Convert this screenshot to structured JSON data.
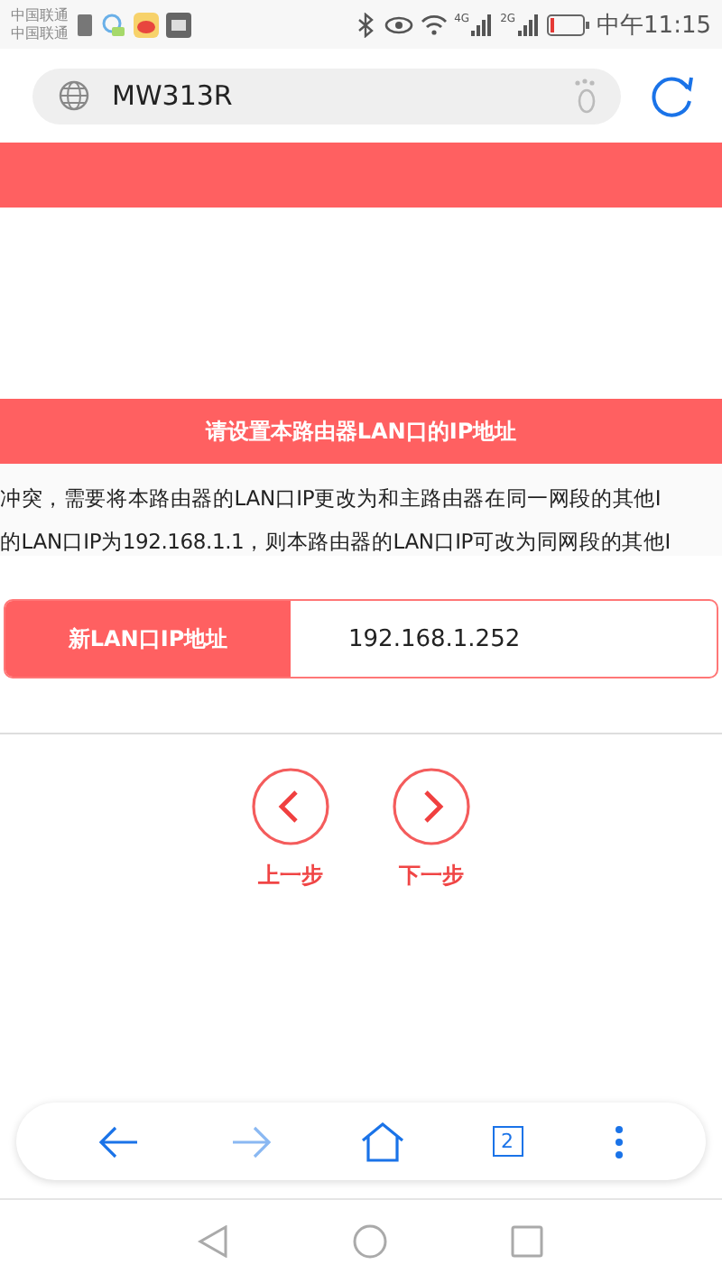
{
  "status_bar": {
    "carriers": [
      "中国联通",
      "中国联通"
    ],
    "network_labels": [
      "4G",
      "2G"
    ],
    "time": "中午11:15"
  },
  "address_bar": {
    "value": "MW313R"
  },
  "page": {
    "section_title": "请设置本路由器LAN口的IP地址",
    "description_lines": [
      "冲突，需要将本路由器的LAN口IP更改为和主路由器在同一网段的其他I",
      "的LAN口IP为192.168.1.1，则本路由器的LAN口IP可改为同网段的其他I"
    ],
    "field": {
      "label": "新LAN口IP地址",
      "value": "192.168.1.252"
    },
    "nav_buttons": [
      {
        "kind": "prev",
        "label": "上一步"
      },
      {
        "kind": "next",
        "label": "下一步"
      }
    ]
  },
  "toolbar": {
    "tab_count": "2",
    "forward_disabled": true
  }
}
